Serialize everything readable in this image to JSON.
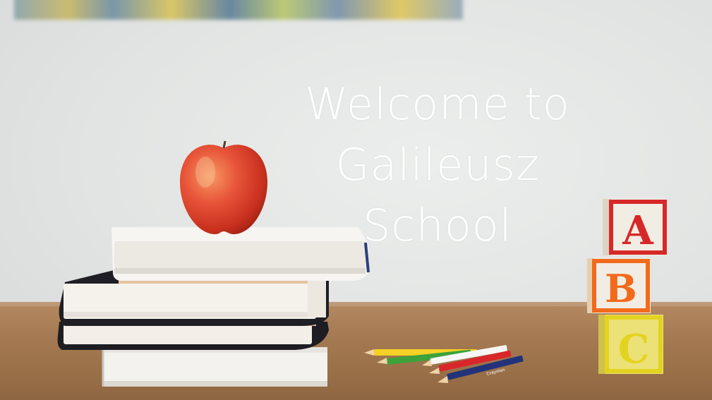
{
  "hero": {
    "title_line1": "Welcome to",
    "title_line2": "Galileusz School"
  },
  "blocks": {
    "letters": [
      "A",
      "B",
      "C"
    ],
    "colors": [
      "#d62828",
      "#f26a1b",
      "#e3d321"
    ]
  },
  "pencil_brand": "Crayolan"
}
